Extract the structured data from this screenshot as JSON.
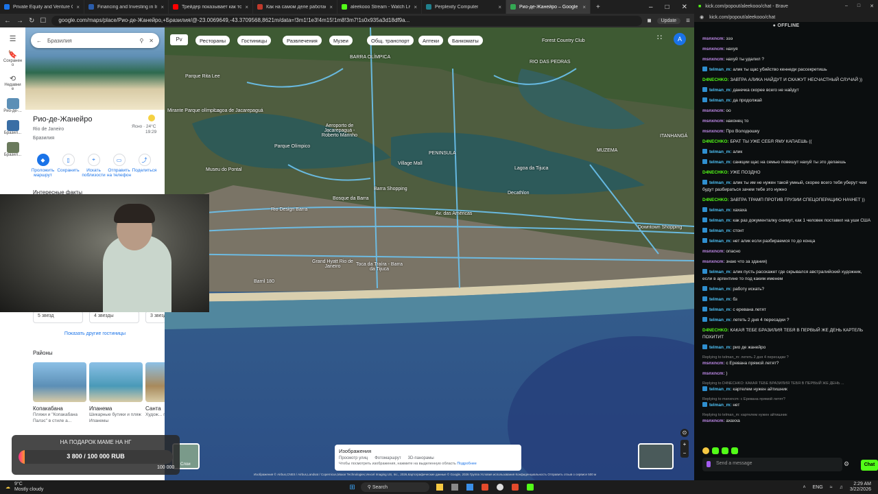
{
  "browser": {
    "tabs": [
      {
        "title": "Private Equity and Venture Capital |",
        "color": "#1a73e8"
      },
      {
        "title": "Financing and Investing in Infrastruct",
        "color": "#2a5caa"
      },
      {
        "title": "Трейдер показывает как торговать",
        "color": "#ff0000"
      },
      {
        "title": "Как на самом деле работает ИИ - ...",
        "color": "#c0392b"
      },
      {
        "title": "aleekooo Stream - Watch Live on Ki",
        "color": "#53fc18"
      },
      {
        "title": "Perplexity Computer",
        "color": "#20808d"
      },
      {
        "title": "Рио-де-Жанейро – Google Карт",
        "color": "#34a853"
      }
    ],
    "url": "google.com/maps/place/Рио-де-Жанейро,+Бразилия/@-23.0069649,-43.3709568,8621m/data=!3m1!1e3!4m15!1m8!3m7!1s0x935a3d18df9a...",
    "update_label": "Update",
    "new_tab": "+"
  },
  "rail": {
    "items": [
      {
        "icon": "bookmark-icon",
        "label": "Сохранен\nо"
      },
      {
        "icon": "history-icon",
        "label": "Недавни\nе"
      },
      {
        "icon": "place-icon",
        "label": "Рио-де-..."
      },
      {
        "icon": "place-icon",
        "label": "Бразил..."
      },
      {
        "icon": "place-icon",
        "label": "Бразил..."
      }
    ]
  },
  "panel": {
    "search_value": "Бразилия",
    "title": "Рио-де-Жанейро",
    "subtitle": "Rio de Janeiro",
    "country": "Бразилия",
    "weather_desc": "Ясно · 24°C",
    "weather_time": "19:29",
    "actions": [
      {
        "label": "Проложить маршрут",
        "icon": "directions-icon"
      },
      {
        "label": "Сохранить",
        "icon": "bookmark-icon"
      },
      {
        "label": "Искать поблизости",
        "icon": "nearby-icon"
      },
      {
        "label": "Отправить на телефон",
        "icon": "phone-icon"
      },
      {
        "label": "Поделиться",
        "icon": "share-icon"
      }
    ],
    "facts_heading": "Интересные факты",
    "hotel_filters": [
      "5 звезд",
      "4 звезды",
      "3 звезды"
    ],
    "show_hotels": "Показать другие гостиницы",
    "districts_heading": "Районы",
    "districts": [
      {
        "name": "Копакабана",
        "desc": "Пляжи и \"Копакабана Палэс\" в стиле а...",
        "color": "#5c8fb6"
      },
      {
        "name": "Ипанема",
        "desc": "Шикарные бутики и пляж Ипанемы",
        "color": "#4a9ab8"
      },
      {
        "name": "Санта",
        "desc": "Худож... галер... театр...",
        "color": "#a88a5c"
      }
    ]
  },
  "map": {
    "layers_label": "Рv",
    "chips": [
      "Рестораны",
      "Гостиницы",
      "Развлечения",
      "Музеи",
      "Общ. транспорт",
      "Аптеки",
      "Банкоматы"
    ],
    "labels": [
      {
        "text": "Forest Country Club"
      },
      {
        "text": "RIO DAS PEDRAS"
      },
      {
        "text": "BARRA OLÍMPICA"
      },
      {
        "text": "Parque Rita Lee"
      },
      {
        "text": "Mirante Parque olímpico"
      },
      {
        "text": "Lagoa de Jacarepaguá"
      },
      {
        "text": "Aeroporto de Jacarepaguá - Roberto Marinho"
      },
      {
        "text": "PENINSULA"
      },
      {
        "text": "Lagoa da Tijuca"
      },
      {
        "text": "Village Mall"
      },
      {
        "text": "Barra Shopping"
      },
      {
        "text": "Museu do Pontal"
      },
      {
        "text": "Bosque da Barra"
      },
      {
        "text": "Rio Design Barra"
      },
      {
        "text": "Grand Hyatt Rio de Janeiro"
      },
      {
        "text": "Toca da Traíra - Barra da Tijuca"
      },
      {
        "text": "Barril 180"
      },
      {
        "text": "Downtown Shopping"
      },
      {
        "text": "Decathlon"
      },
      {
        "text": "MUZEMA"
      },
      {
        "text": "ITANHANGÁ"
      },
      {
        "text": "Av. das Américas"
      },
      {
        "text": "Parque Olímpico"
      }
    ],
    "images_card": {
      "title": "Изображения",
      "opt1": "Просмотр улиц",
      "opt2": "Фотомаршрут",
      "opt3": "3D-панорамы",
      "hint": "Чтобы посмотреть изображения, нажмите на выделенную область",
      "link": "Подробнее"
    },
    "layer_toggle": "Слои",
    "footer": "Изображения © Airbus,CNES / Airbus,Landsat / Copernicus,Maxar Technologies,Vexcel Imaging US, Inc., 2026,Картографические данные © Google, 2026   Группа   Условия использования   Конфиденциальность   Отправить отзыв о сервисе   500 м"
  },
  "stream": {
    "donation_title": "НА ПОДАРОК МАМЕ НА НГ",
    "donation_amount": "3 800 / 100 000 RUB",
    "donation_progress": 0.038,
    "overlay_amount": "100 000"
  },
  "chat": {
    "window_title": "kick.com/popout/aleekooo/chat - Brave",
    "url": "kick.com/popout/aleekooo/chat",
    "status": "OFFLINE",
    "messages": [
      {
        "user": "msnxncm:",
        "color": "#c58ef0",
        "text": "эээ",
        "badge": false
      },
      {
        "user": "msnxncm:",
        "color": "#c58ef0",
        "text": "нахуя",
        "badge": false
      },
      {
        "user": "msnxncm:",
        "color": "#c58ef0",
        "text": "нахуй ты удалил ?",
        "badge": false
      },
      {
        "user": "telman_m:",
        "color": "#4fc3f7",
        "text": "алик ты щас убийство кеннеди рассекретишь",
        "badge": true
      },
      {
        "user": "D4NECHKO:",
        "color": "#53fc18",
        "text": "ЗАВТРА АЛИКА НАЙДУТ И СКАЖУТ НЕСЧАСТНЫЙ СЛУЧАЙ ))",
        "badge": false
      },
      {
        "user": "telman_m:",
        "color": "#4fc3f7",
        "text": "данечка скорее всего не найдут",
        "badge": true
      },
      {
        "user": "telman_m:",
        "color": "#4fc3f7",
        "text": "да продолжай",
        "badge": true
      },
      {
        "user": "msnxncm:",
        "color": "#c58ef0",
        "text": "оо",
        "badge": false
      },
      {
        "user": "msnxncm:",
        "color": "#c58ef0",
        "text": "наконец то",
        "badge": false
      },
      {
        "user": "msnxncm:",
        "color": "#c58ef0",
        "text": "Про Володюшку",
        "badge": false
      },
      {
        "user": "D4NECHKO:",
        "color": "#53fc18",
        "text": "БРАТ ТЫ УЖЕ СЕБЯ ЯМУ КАПАЕШЬ ((",
        "badge": false
      },
      {
        "user": "telman_m:",
        "color": "#4fc3f7",
        "text": "алик",
        "badge": true
      },
      {
        "user": "telman_m:",
        "color": "#4fc3f7",
        "text": "санкции щас на семью повешут нахуй ты это делаешь",
        "badge": true
      },
      {
        "user": "D4NECHKO:",
        "color": "#53fc18",
        "text": "УЖЕ ПОЗДНО",
        "badge": false
      },
      {
        "user": "telman_m:",
        "color": "#4fc3f7",
        "text": "алик ты им не нужен такой умный, скорее всего тебя уберут чем будут разбираться зачем тебе это нужно",
        "badge": true
      },
      {
        "user": "D4NECHKO:",
        "color": "#53fc18",
        "text": "ЗАВТРА ТРАМП ПРОТИВ ГРУЗИИ СПЕЦОПЕРАЦИЮ НАЧНЕТ ))",
        "badge": false
      },
      {
        "user": "telman_m:",
        "color": "#4fc3f7",
        "text": "хахаха",
        "badge": true
      },
      {
        "user": "telman_m:",
        "color": "#4fc3f7",
        "text": "как раз документалку снимут, как 1 человек поставил на уши США",
        "badge": true
      },
      {
        "user": "telman_m:",
        "color": "#4fc3f7",
        "text": "стонт",
        "badge": true
      },
      {
        "user": "telman_m:",
        "color": "#4fc3f7",
        "text": "нет алик если разбираемся то до конца",
        "badge": true
      },
      {
        "user": "msnxncm:",
        "color": "#c58ef0",
        "text": "опасно",
        "badge": false
      },
      {
        "user": "msnxncm:",
        "color": "#c58ef0",
        "text": "знаю что за здания)",
        "badge": false
      },
      {
        "user": "telman_m:",
        "color": "#4fc3f7",
        "text": "алик пусть расскажет где скрывался австралийский художник, если в аргентине то под каким именем",
        "badge": true
      },
      {
        "user": "telman_m:",
        "color": "#4fc3f7",
        "text": "работу искать?",
        "badge": true
      },
      {
        "user": "telman_m:",
        "color": "#4fc3f7",
        "text": "бз",
        "badge": true
      },
      {
        "user": "telman_m:",
        "color": "#4fc3f7",
        "text": "с еревана летят",
        "badge": true
      },
      {
        "user": "telman_m:",
        "color": "#4fc3f7",
        "text": "лететь 2 дня 4 пересадки ?",
        "badge": true
      },
      {
        "user": "D4NECHKO:",
        "color": "#53fc18",
        "text": "КАКАЯ ТЕБЕ БРАЗИЛИЯ ТЕБЯ В ПЕРВЫЙ ЖЕ ДЕНЬ КАРТЕЛЬ ПОХИТИТ",
        "badge": false
      },
      {
        "user": "telman_m:",
        "color": "#4fc3f7",
        "text": "рио де жанейро",
        "badge": true
      },
      {
        "reply": "Replying to telman_m: лететь 2 дня 4 пересадки ?",
        "user": "msnxncm:",
        "color": "#c58ef0",
        "text": "с Еревана прямой летят?",
        "badge": false
      },
      {
        "user": "msnxncm:",
        "color": "#c58ef0",
        "text": ")",
        "badge": false
      },
      {
        "reply": "Replying to D4NECHKO: КАКАЯ ТЕБЕ БРАЗИЛИЯ ТЕБЯ В ПЕРВЫЙ ЖЕ ДЕНЬ ...",
        "user": "telman_m:",
        "color": "#4fc3f7",
        "text": "картелем нужен айтишник",
        "badge": true
      },
      {
        "reply": "Replying to msnxncm: с Еревана прямой летят?",
        "user": "telman_m:",
        "color": "#4fc3f7",
        "text": "нет",
        "badge": true
      },
      {
        "reply": "Replying to telman_m: картелем нужен айтишник",
        "user": "msnxncm:",
        "color": "#c58ef0",
        "text": "ахахха",
        "badge": false
      }
    ],
    "input_placeholder": "Send a message",
    "send_label": "Chat"
  },
  "taskbar": {
    "weather_temp": "9°C",
    "weather_desc": "Mostly cloudy",
    "search_placeholder": "Search",
    "lang": "ENG",
    "time": "2:29 AM",
    "date": "3/22/2026"
  }
}
